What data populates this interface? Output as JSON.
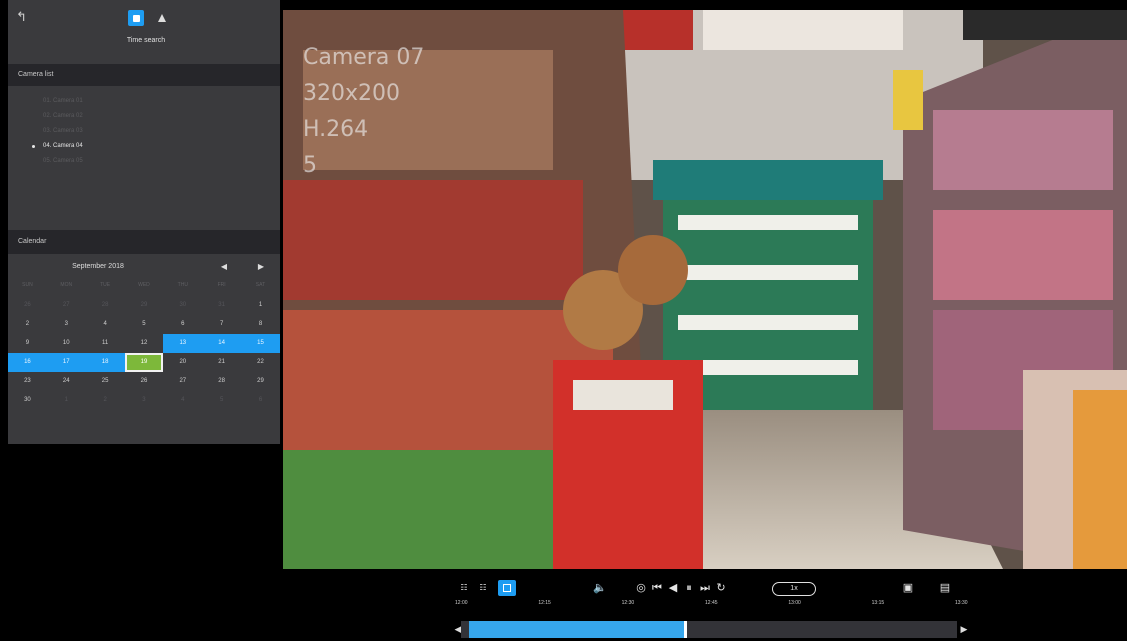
{
  "mode": {
    "label": "Time search"
  },
  "cameras": {
    "header": "Camera list",
    "items": [
      {
        "label": "01. Camera 01",
        "active": false
      },
      {
        "label": "02. Camera 02",
        "active": false
      },
      {
        "label": "03. Camera 03",
        "active": false
      },
      {
        "label": "04. Camera 04",
        "active": true
      },
      {
        "label": "05. Camera 05",
        "active": false
      }
    ]
  },
  "calendar": {
    "header": "Calendar",
    "month_label": "September 2018",
    "prev": "◀",
    "next": "▶",
    "weekdays": [
      "SUN",
      "MON",
      "TUE",
      "WED",
      "THU",
      "FRI",
      "SAT"
    ],
    "days": [
      {
        "d": "26",
        "s": "muted"
      },
      {
        "d": "27",
        "s": "muted"
      },
      {
        "d": "28",
        "s": "muted"
      },
      {
        "d": "29",
        "s": "muted"
      },
      {
        "d": "30",
        "s": "muted"
      },
      {
        "d": "31",
        "s": "muted"
      },
      {
        "d": "1",
        "s": ""
      },
      {
        "d": "2",
        "s": ""
      },
      {
        "d": "3",
        "s": ""
      },
      {
        "d": "4",
        "s": ""
      },
      {
        "d": "5",
        "s": ""
      },
      {
        "d": "6",
        "s": ""
      },
      {
        "d": "7",
        "s": ""
      },
      {
        "d": "8",
        "s": ""
      },
      {
        "d": "9",
        "s": ""
      },
      {
        "d": "10",
        "s": ""
      },
      {
        "d": "11",
        "s": ""
      },
      {
        "d": "12",
        "s": ""
      },
      {
        "d": "13",
        "s": "range"
      },
      {
        "d": "14",
        "s": "range"
      },
      {
        "d": "15",
        "s": "range"
      },
      {
        "d": "16",
        "s": "range"
      },
      {
        "d": "17",
        "s": "range"
      },
      {
        "d": "18",
        "s": "range"
      },
      {
        "d": "19",
        "s": "today"
      },
      {
        "d": "20",
        "s": ""
      },
      {
        "d": "21",
        "s": ""
      },
      {
        "d": "22",
        "s": ""
      },
      {
        "d": "23",
        "s": ""
      },
      {
        "d": "24",
        "s": ""
      },
      {
        "d": "25",
        "s": ""
      },
      {
        "d": "26",
        "s": ""
      },
      {
        "d": "27",
        "s": ""
      },
      {
        "d": "28",
        "s": ""
      },
      {
        "d": "29",
        "s": ""
      },
      {
        "d": "30",
        "s": ""
      },
      {
        "d": "1",
        "s": "muted"
      },
      {
        "d": "2",
        "s": "muted"
      },
      {
        "d": "3",
        "s": "muted"
      },
      {
        "d": "4",
        "s": "muted"
      },
      {
        "d": "5",
        "s": "muted"
      },
      {
        "d": "6",
        "s": "muted"
      }
    ]
  },
  "video": {
    "osd": [
      "Camera 07",
      "320x200",
      "H.264",
      "5"
    ]
  },
  "playback": {
    "speed": "1x",
    "ticks": [
      "12:00",
      "12:15",
      "12:30",
      "12:45",
      "13:00",
      "13:15",
      "13:30"
    ],
    "progress": 0.44
  },
  "colors": {
    "accent": "#1e9df2",
    "today": "#7db83a",
    "panel": "#3a3a3d"
  }
}
